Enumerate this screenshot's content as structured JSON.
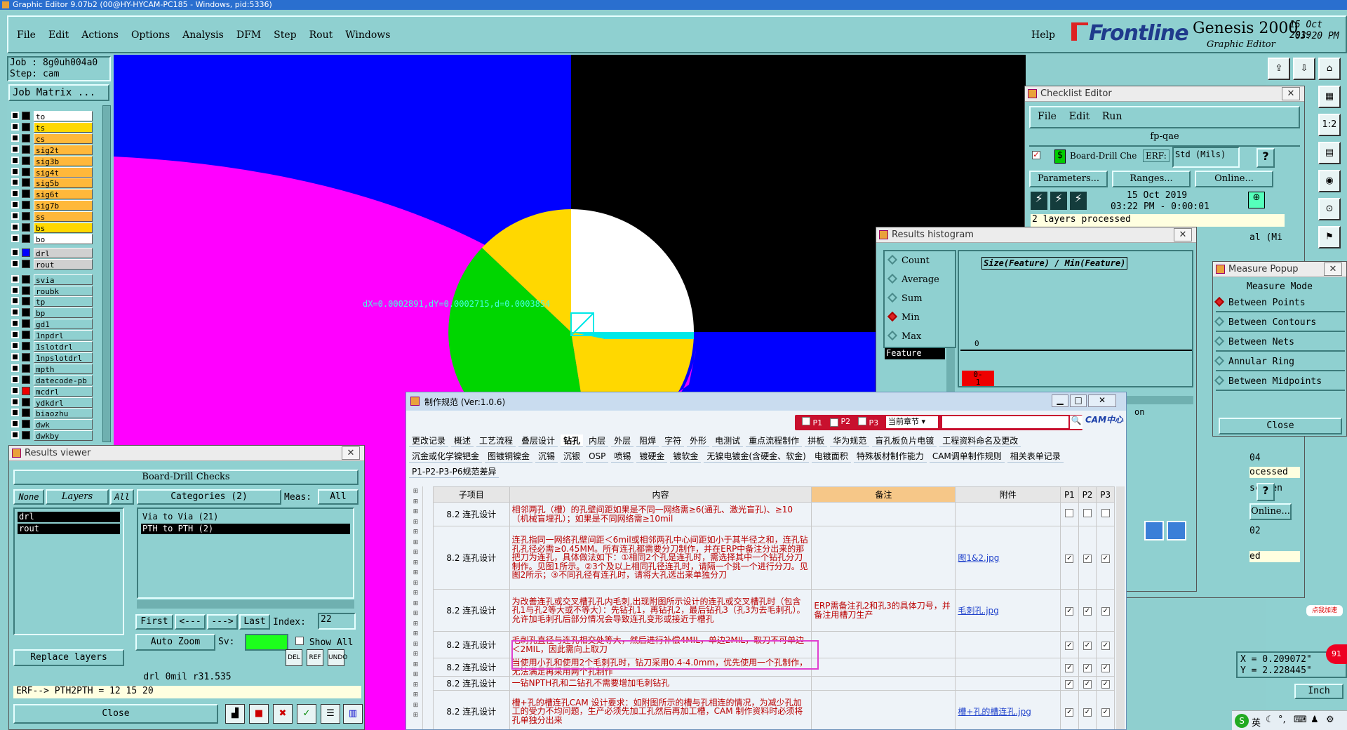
{
  "app": {
    "title": "Graphic Editor 9.07b2 (00@HY-HYCAM-PC185 - Windows, pid:5336)",
    "menu": [
      "File",
      "Edit",
      "Actions",
      "Options",
      "Analysis",
      "DFM",
      "Step",
      "Rout",
      "Windows"
    ],
    "help": "Help",
    "brand": "Frontline",
    "product": "Genesis 2000",
    "subtitle": "Graphic Editor",
    "date": "15 Oct 2019",
    "time": "03:20 PM"
  },
  "job": {
    "job": "Job : 8g0uh004a0",
    "step": "Step: cam",
    "matrix": "Job Matrix ..."
  },
  "layers": [
    "to",
    "ts",
    "cs",
    "sig2t",
    "sig3b",
    "sig4t",
    "sig5b",
    "sig6t",
    "sig7b",
    "ss",
    "bs",
    "bo",
    "drl",
    "rout",
    "svia",
    "roubk",
    "tp",
    "bp",
    "gd1",
    "1npdrl",
    "1slotdrl",
    "1npslotdrl",
    "mpth",
    "datecode-pb",
    "mcdrl",
    "ydkdrl",
    "biaozhu",
    "dwk",
    "dwkby"
  ],
  "canvas": {
    "measure_text": "dX=0.0002891,dY=0.0002715,d=0.0003854"
  },
  "results_viewer": {
    "title": "Results viewer",
    "header": "Board-Drill Checks",
    "none": "None",
    "layers": "Layers",
    "all": "All",
    "categories": "Categories (2)",
    "meas": "Meas:",
    "meas_val": "All",
    "layer_items": [
      "drl",
      "rout"
    ],
    "cat_items": [
      "Via to Via   (21)",
      "PTH to PTH   (2)"
    ],
    "first": "First",
    "prev": "<---",
    "next": "--->",
    "last": "Last",
    "index": "Index:",
    "index_val": "22",
    "autozoom": "Auto Zoom",
    "sv": "Sv:",
    "showall": "Show All",
    "replace": "Replace layers",
    "status1": "drl   0mil   r31.535",
    "status2": "ERF--> PTH2PTH = 12 15 20",
    "close": "Close"
  },
  "checklist": {
    "title": "Checklist Editor",
    "menu": [
      "File",
      "Edit",
      "Run"
    ],
    "name": "fp-qae",
    "action": "Board-Drill Che",
    "erf": "ERF:",
    "units": "Std (Mils)",
    "params": "Parameters...",
    "ranges": "Ranges...",
    "online": "Online...",
    "date": "15 Oct 2019",
    "time": "03:22 PM - 0:00:01",
    "processed": "2 layers processed",
    "frag": [
      "al (Mi",
      "04",
      "ocessed",
      "screen",
      "Online...",
      "02",
      "ed",
      "on"
    ]
  },
  "histogram": {
    "title": "Results histogram",
    "opts": [
      "Count",
      "Average",
      "Sum",
      "Min",
      "Max"
    ],
    "feature": "Feature",
    "axis": "Size(Feature) / Min(Feature)",
    "zero": "0",
    "bar": "0-\n1"
  },
  "measure": {
    "title": "Measure Popup",
    "mode": "Measure Mode",
    "opts": [
      "Between Points",
      "Between Contours",
      "Between Nets",
      "Annular Ring",
      "Between Midpoints"
    ],
    "close": "Close"
  },
  "coords": {
    "x": "X = 0.209072\"",
    "y": "Y = 2.228445\"",
    "unit": "Inch"
  },
  "spec": {
    "title": "制作规范 (Ver:1.0.6)",
    "p1": "P1",
    "p2": "P2",
    "p3": "P3",
    "chapter": "当前章节",
    "logo": "CAM中心",
    "tabs1": [
      "更改记录",
      "概述",
      "工艺流程",
      "叠层设计",
      "钻孔",
      "内层",
      "外层",
      "阻焊",
      "字符",
      "外形",
      "电测试",
      "重点流程制作",
      "拼板",
      "华为规范",
      "盲孔板负片电镀",
      "工程资料命名及更改"
    ],
    "tabs2": [
      "沉金或化学镍钯金",
      "图镀铜镍金",
      "沉锡",
      "沉银",
      "OSP",
      "喷锡",
      "镀硬金",
      "镀软金",
      "无镍电镀金(含硬金、软金)",
      "电镀面积",
      "特殊板材制作能力",
      "CAM调单制作规则",
      "相关表单记录"
    ],
    "tabs3": [
      "P1-P2-P3-P6规范差异"
    ],
    "headers": [
      "子项目",
      "内容",
      "备注",
      "附件",
      "P1",
      "P2",
      "P3"
    ],
    "rows": [
      {
        "sub": "8.2 连孔设计",
        "content": "相邻两孔（槽）的孔壁间距如果是不同一网络需≥6(通孔、激光盲孔)、≥10（机械盲埋孔）；如果是不同网络需≥10mil",
        "note": "",
        "att": ""
      },
      {
        "sub": "8.2 连孔设计",
        "content": "连孔指同一网络孔壁间距＜6mil或相邻两孔中心间距如小于其半径之和，连孔钻孔孔径必需≥0.45MM。所有连孔都需要分刀制作，并在ERP中备注分出来的那把刀为连孔，具体做法如下：①相同2个孔是连孔时，需选择其中一个钻孔分刀制作。见图1所示。②3个及以上相同孔径连孔时，请隔一个挑一个进行分刀。见图2所示；③不同孔径有连孔时，请将大孔选出来单独分刀",
        "note": "",
        "att": "图1&2.jpg"
      },
      {
        "sub": "8.2 连孔设计",
        "content": "为改善连孔或交叉槽孔孔内毛刺,出现附图所示设计的连孔或交叉槽孔时（包含孔1与孔2等大或不等大）：先钻孔1，再钻孔2，最后钻孔3（孔3为去毛刺孔）。允许加毛刺孔后部分情况会导致连孔变形或接近于槽孔",
        "note": "ERP需备注孔2和孔3的具体刀号，并备注用槽刀生产",
        "att": "毛刺孔.jpg"
      },
      {
        "sub": "8.2 连孔设计",
        "content": "毛刺孔直径与连孔相交处等大，然后进行补偿4MIL，单边2MIL，取刀不可单边＜2MIL，因此需向上取刀",
        "note": "",
        "att": ""
      },
      {
        "sub": "8.2 连孔设计",
        "content": "当使用小孔和使用2个毛刺孔时，钻刀采用0.4-4.0mm，优先使用一个孔制作，无法满足再采用两个孔制作",
        "note": "",
        "att": ""
      },
      {
        "sub": "8.2 连孔设计",
        "content": "一钻NPTH孔和二钻孔不需要增加毛刺钻孔",
        "note": "",
        "att": ""
      },
      {
        "sub": "8.2 连孔设计",
        "content": "槽+孔的槽连孔CAM 设计要求：如附图所示的槽与孔相连的情况，为减少孔加工的受力不均问题，生产必须先加工孔然后再加工槽，CAM 制作资料时必须将孔单独分出来",
        "note": "",
        "att": "槽+孔的槽连孔.jpg"
      }
    ]
  },
  "taskbar": {
    "ime": "英",
    "badge": "点我加速",
    "num": "91"
  },
  "colors": {
    "teal": "#8fd0d0",
    "canvas_blue": "#0000ff",
    "magenta": "#ff00ff",
    "yellow": "#ffd800",
    "green": "#00d600"
  }
}
